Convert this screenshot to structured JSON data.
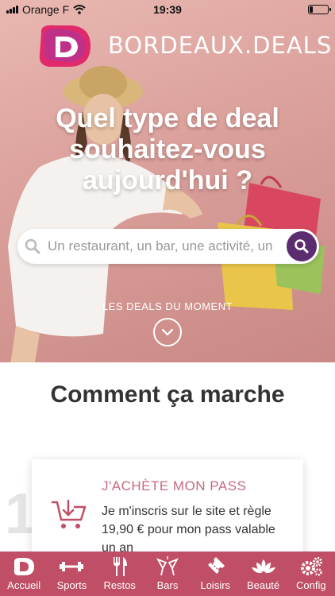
{
  "status_bar": {
    "carrier": "Orange F",
    "time": "19:39",
    "battery_level": 0.2
  },
  "hero": {
    "logo_text": "BORDEAUX.DEALS",
    "title": "Quel type de deal souhaitez-vous aujourd'hui ?",
    "search": {
      "placeholder": "Un restaurant, un bar, une activité, un"
    },
    "deals_label": "LES DEALS DU MOMENT"
  },
  "how_it_works": {
    "title": "Comment ça marche",
    "step_number": "1",
    "step": {
      "heading": "J'ACHÈTE MON PASS",
      "text": "Je m'inscris sur le site et règle 19,90 € pour mon pass valable un an"
    }
  },
  "tabs": [
    {
      "label": "Accueil",
      "icon": "logo-icon"
    },
    {
      "label": "Sports",
      "icon": "dumbbell-icon"
    },
    {
      "label": "Restos",
      "icon": "cutlery-icon"
    },
    {
      "label": "Bars",
      "icon": "cocktail-glasses-icon"
    },
    {
      "label": "Loisirs",
      "icon": "ticket-icon"
    },
    {
      "label": "Beauté",
      "icon": "lotus-icon"
    },
    {
      "label": "Config",
      "icon": "gears-icon"
    }
  ],
  "colors": {
    "brand": "#c04e66",
    "accent_purple": "#5b2c6f",
    "heading_pink": "#c56b7f"
  }
}
